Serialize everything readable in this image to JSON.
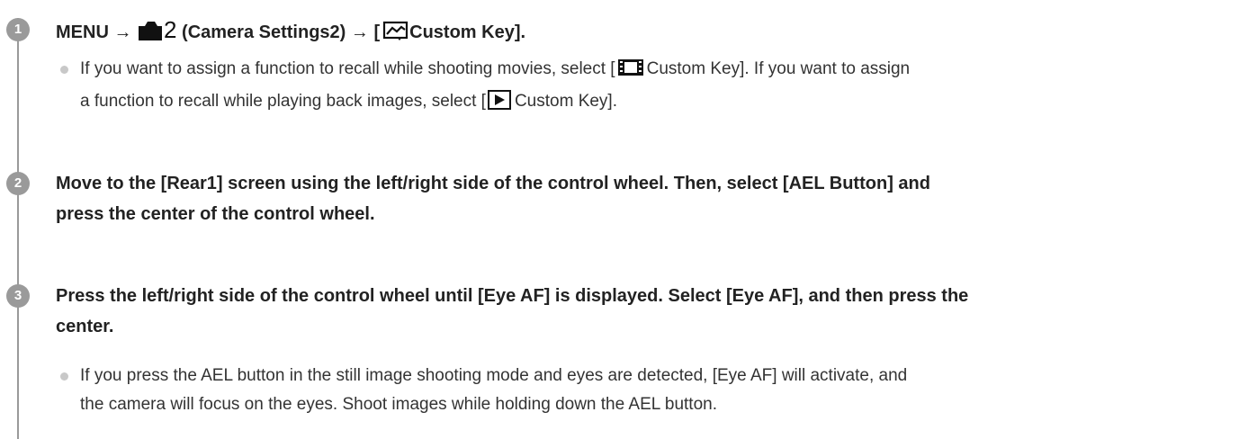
{
  "steps": [
    {
      "number": "1",
      "heading": {
        "menu": "MENU",
        "arrow1": "→",
        "settings_number": "2",
        "settings_label": "(Camera Settings2)",
        "arrow2": "→",
        "bracket_open": "[",
        "key_label": "Custom Key].",
        "camera_icon": "camera-icon",
        "custom_key_icon": "custom-key-still-icon"
      },
      "note": {
        "part1": "If you want to assign a function to recall while shooting movies, select [",
        "part2": "Custom Key]. If you want to assign",
        "part3": "a function to recall while playing back images, select [",
        "part4": "Custom Key].",
        "movie_icon": "movie-icon",
        "playback_icon": "playback-icon"
      }
    },
    {
      "number": "2",
      "heading_line1": "Move to the [Rear1] screen using the left/right side of the control wheel. Then, select [AEL Button] and",
      "heading_line2": "press the center of the control wheel."
    },
    {
      "number": "3",
      "heading_line1": "Press the left/right side of the control wheel until [Eye AF] is displayed. Select [Eye AF], and then press the",
      "heading_line2": "center.",
      "note_line1": "If you press the AEL button in the still image shooting mode and eyes are detected, [Eye AF] will activate, and",
      "note_line2": "the camera will focus on the eyes. Shoot images while holding down the AEL button."
    }
  ],
  "colors": {
    "step_circle": "#9a9a9a",
    "bullet": "#c8c8c8",
    "text": "#222222"
  }
}
